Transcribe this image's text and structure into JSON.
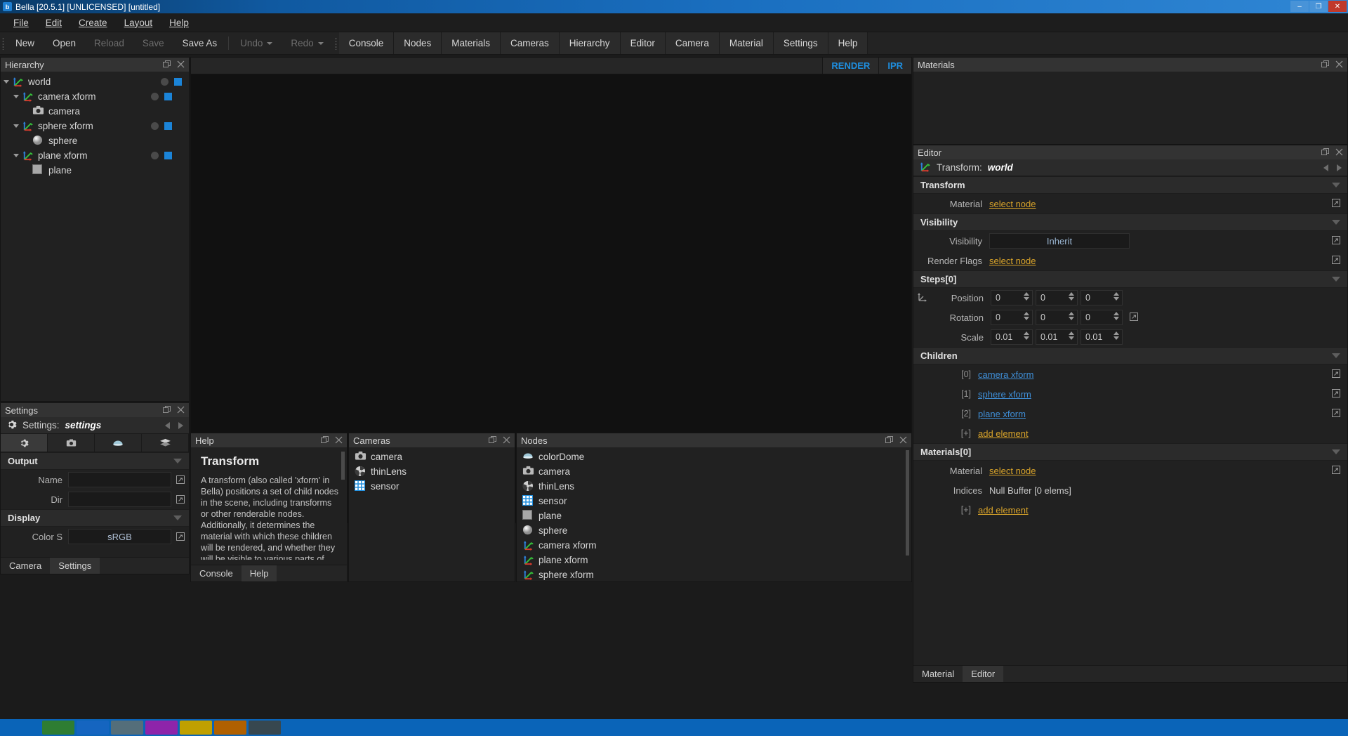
{
  "window": {
    "title": "Bella [20.5.1] [UNLICENSED] [untitled]",
    "minimize": "–",
    "maximize": "❐",
    "close": "✕"
  },
  "menubar": {
    "items": [
      "File",
      "Edit",
      "Create",
      "Layout",
      "Help"
    ]
  },
  "toolbar": {
    "actions": [
      {
        "label": "New",
        "enabled": true
      },
      {
        "label": "Open",
        "enabled": true
      },
      {
        "label": "Reload",
        "enabled": false
      },
      {
        "label": "Save",
        "enabled": false
      },
      {
        "label": "Save As",
        "enabled": true
      }
    ],
    "history": [
      {
        "label": "Undo",
        "enabled": false
      },
      {
        "label": "Redo",
        "enabled": false
      }
    ],
    "tabs": [
      "Console",
      "Nodes",
      "Materials",
      "Cameras",
      "Hierarchy",
      "Editor",
      "Camera",
      "Material",
      "Settings",
      "Help"
    ]
  },
  "hierarchy": {
    "title": "Hierarchy",
    "nodes": [
      {
        "label": "world",
        "icon": "axis-icon",
        "depth": 0,
        "expandable": true,
        "toggles": true
      },
      {
        "label": "camera xform",
        "icon": "axis-icon",
        "depth": 1,
        "expandable": true,
        "toggles": true
      },
      {
        "label": "camera",
        "icon": "camera-icon",
        "depth": 2,
        "expandable": false,
        "toggles": false
      },
      {
        "label": "sphere xform",
        "icon": "axis-icon",
        "depth": 1,
        "expandable": true,
        "toggles": true
      },
      {
        "label": "sphere",
        "icon": "sphere-icon",
        "depth": 2,
        "expandable": false,
        "toggles": false
      },
      {
        "label": "plane xform",
        "icon": "axis-icon",
        "depth": 1,
        "expandable": true,
        "toggles": true
      },
      {
        "label": "plane",
        "icon": "plane-icon",
        "depth": 2,
        "expandable": false,
        "toggles": false
      }
    ]
  },
  "settings_panel": {
    "title": "Settings",
    "node_label": "Settings:",
    "node_value": "settings",
    "icon_tabs": [
      "gear-icon",
      "camera-icon",
      "dome-icon",
      "layers-icon"
    ],
    "sections": [
      {
        "name": "Output",
        "rows": [
          {
            "label": "Name",
            "value": ""
          },
          {
            "label": "Dir",
            "value": ""
          }
        ]
      },
      {
        "name": "Display",
        "rows": [
          {
            "label": "Color S",
            "value": "sRGB"
          }
        ]
      }
    ],
    "bottom_tabs": [
      "Camera",
      "Settings"
    ],
    "active_bottom_tab": "Settings"
  },
  "viewport": {
    "buttons": [
      "RENDER",
      "IPR"
    ]
  },
  "help_panel": {
    "title": "Help",
    "heading": "Transform",
    "body": "A transform (also called 'xform' in Bella) positions a set of child nodes in the scene, including transforms or other renderable nodes. Additionally, it determines the material with which these children will be rendered, and whether they will be visible to various parts of the rendering process.",
    "tabs": [
      "Console",
      "Help"
    ],
    "active_tab": "Help"
  },
  "cameras_panel": {
    "title": "Cameras",
    "items": [
      {
        "label": "camera",
        "icon": "camera-icon"
      },
      {
        "label": "thinLens",
        "icon": "aperture-icon"
      },
      {
        "label": "sensor",
        "icon": "sensor-grid-icon"
      }
    ]
  },
  "nodes_panel": {
    "title": "Nodes",
    "items": [
      {
        "label": "colorDome",
        "icon": "dome-icon"
      },
      {
        "label": "camera",
        "icon": "camera-icon"
      },
      {
        "label": "thinLens",
        "icon": "aperture-icon"
      },
      {
        "label": "sensor",
        "icon": "sensor-grid-icon"
      },
      {
        "label": "plane",
        "icon": "plane-icon"
      },
      {
        "label": "sphere",
        "icon": "sphere-icon"
      },
      {
        "label": "camera xform",
        "icon": "axis-icon"
      },
      {
        "label": "plane xform",
        "icon": "axis-icon"
      },
      {
        "label": "sphere xform",
        "icon": "axis-icon"
      }
    ]
  },
  "materials_panel": {
    "title": "Materials",
    "items": []
  },
  "editor_panel": {
    "title": "Editor",
    "node_label": "Transform:",
    "node_value": "world",
    "sections": {
      "transform": {
        "name": "Transform",
        "material_label": "Material",
        "material_value": "select node"
      },
      "visibility": {
        "name": "Visibility",
        "visibility_label": "Visibility",
        "visibility_value": "Inherit",
        "render_flags_label": "Render Flags",
        "render_flags_value": "select node"
      },
      "steps": {
        "name": "Steps[0]",
        "rows": [
          {
            "label": "Position",
            "values": [
              "0",
              "0",
              "0"
            ]
          },
          {
            "label": "Rotation",
            "values": [
              "0",
              "0",
              "0"
            ]
          },
          {
            "label": "Scale",
            "values": [
              "0.01",
              "0.01",
              "0.01"
            ]
          }
        ]
      },
      "children": {
        "name": "Children",
        "items": [
          {
            "index": "[0]",
            "label": "camera xform"
          },
          {
            "index": "[1]",
            "label": "sphere xform"
          },
          {
            "index": "[2]",
            "label": "plane xform"
          }
        ],
        "add_index": "[+]",
        "add_label": "add element"
      },
      "materials": {
        "name": "Materials[0]",
        "material_label": "Material",
        "material_value": "select node",
        "indices_label": "Indices",
        "indices_value": "Null Buffer [0 elems]",
        "add_index": "[+]",
        "add_label": "add element"
      }
    },
    "bottom_tabs": [
      "Material",
      "Editor"
    ],
    "active_bottom_tab": "Editor"
  },
  "colors": {
    "accent_blue": "#1e8fe0",
    "link_gold": "#d8a32a",
    "link_blue": "#3f8fd8",
    "panel_bg": "#212121",
    "header_bg": "#333333",
    "taskbar": "#0a64b8"
  }
}
